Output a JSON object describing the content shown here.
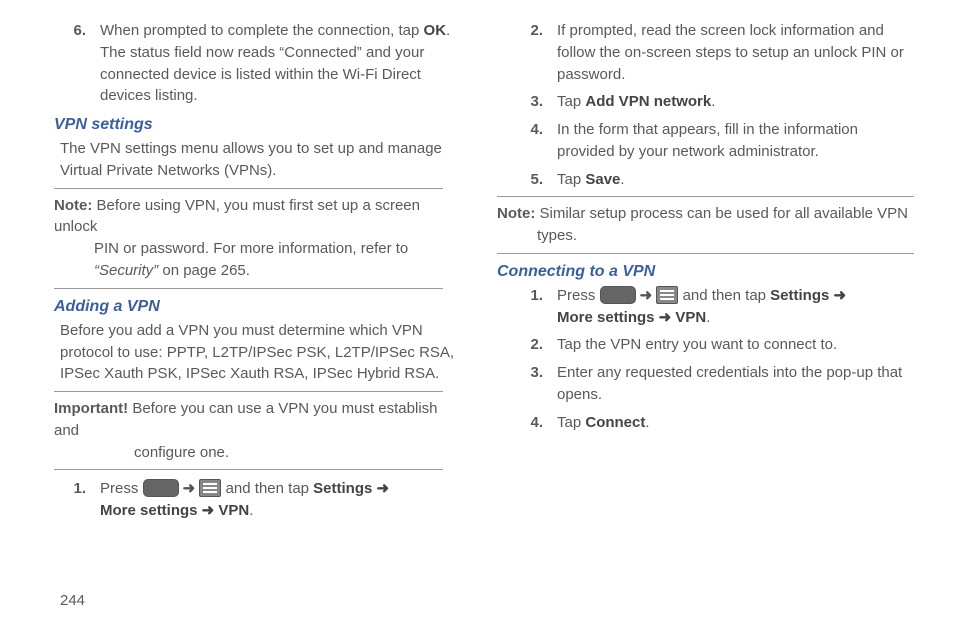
{
  "page_number": "244",
  "left": {
    "step6_num": "6.",
    "step6_pre": "When prompted to complete the connection, tap ",
    "step6_bold": "OK",
    "step6_post": ". The status field now reads “Connected” and your connected device is listed within the Wi-Fi Direct devices listing.",
    "h_vpn": "VPN settings",
    "vpn_desc": "The VPN settings menu allows you to set up and manage Virtual Private Networks (VPNs).",
    "note_lbl": "Note:",
    "note_l1": " Before using VPN, you must first set up a screen unlock ",
    "note_l2": "PIN or password. For more information, refer to ",
    "note_l3a": "“Security”",
    "note_l3b": "  on page 265.",
    "h_add": "Adding a VPN",
    "add_desc": "Before you add a VPN you must determine which VPN protocol to use: PPTP, L2TP/IPSec PSK, L2TP/IPSec RSA, IPSec Xauth PSK, IPSec Xauth RSA, IPSec Hybrid RSA.",
    "imp_lbl": "Important!",
    "imp_l1": " Before you can use a VPN you must establish and ",
    "imp_l2": "configure one.",
    "s1_num": "1.",
    "s1_pre": "Press ",
    "s1_arrow": " ➜ ",
    "s1_mid": " and then tap ",
    "s1_b1": "Settings ➜ ",
    "s1_b2": "More settings ➜ VPN",
    "s1_post": "."
  },
  "right": {
    "s2_num": "2.",
    "s2_txt": "If prompted, read the screen lock information and follow the on-screen steps to setup an unlock PIN or password.",
    "s3_num": "3.",
    "s3_pre": "Tap ",
    "s3_b": "Add VPN network",
    "s3_post": ".",
    "s4_num": "4.",
    "s4_txt": "In the form that appears, fill in the information provided by your network administrator.",
    "s5_num": "5.",
    "s5_pre": "Tap ",
    "s5_b": "Save",
    "s5_post": ".",
    "note_lbl": "Note:",
    "note_l1": " Similar setup process can be used for all available VPN ",
    "note_l2": "types.",
    "h_conn": "Connecting to a VPN",
    "c1_num": "1.",
    "c1_pre": "Press ",
    "c1_arrow": " ➜ ",
    "c1_mid": " and then tap ",
    "c1_b1": "Settings ➜ ",
    "c1_b2": "More settings ➜ VPN",
    "c1_post": ".",
    "c2_num": "2.",
    "c2_txt": "Tap the VPN entry you want to connect to.",
    "c3_num": "3.",
    "c3_txt": "Enter any requested credentials into the pop-up that opens.",
    "c4_num": "4.",
    "c4_pre": "Tap ",
    "c4_b": "Connect",
    "c4_post": "."
  }
}
